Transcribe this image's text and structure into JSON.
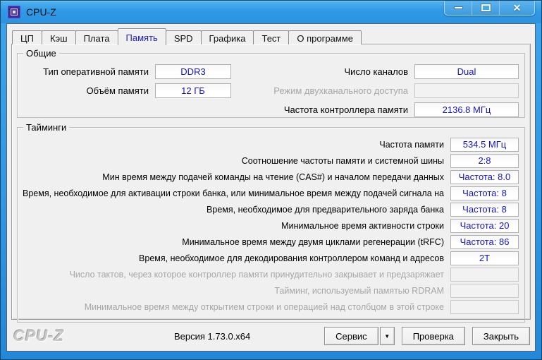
{
  "window": {
    "title": "CPU-Z",
    "controls": {
      "close_glyph": "✕"
    }
  },
  "tabs": [
    {
      "name": "tab-cpu",
      "label": "ЦП",
      "active": false
    },
    {
      "name": "tab-cache",
      "label": "Кэш",
      "active": false
    },
    {
      "name": "tab-mainboard",
      "label": "Плата",
      "active": false
    },
    {
      "name": "tab-memory",
      "label": "Память",
      "active": true
    },
    {
      "name": "tab-spd",
      "label": "SPD",
      "active": false
    },
    {
      "name": "tab-graphics",
      "label": "Графика",
      "active": false
    },
    {
      "name": "tab-bench",
      "label": "Тест",
      "active": false
    },
    {
      "name": "tab-about",
      "label": "О программе",
      "active": false
    }
  ],
  "general": {
    "group_title": "Общие",
    "left": [
      {
        "label": "Тип оперативной памяти",
        "value": "DDR3",
        "disabled": false
      },
      {
        "label": "Объём памяти",
        "value": "12 ГБ",
        "disabled": false
      }
    ],
    "right": [
      {
        "label": "Число каналов",
        "value": "Dual",
        "disabled": false
      },
      {
        "label": "Режим двухканального доступа",
        "value": "",
        "disabled": true
      },
      {
        "label": "Частота контроллера памяти",
        "value": "2136.8 МГц",
        "disabled": false
      }
    ]
  },
  "timings": {
    "group_title": "Тайминги",
    "rows": [
      {
        "label": "Частота памяти",
        "value": "534.5 МГц",
        "disabled": false
      },
      {
        "label": "Соотношение частоты памяти и системной шины",
        "value": "2:8",
        "disabled": false
      },
      {
        "label": "Мин время между подачей команды на чтение (CAS#) и началом передачи данных",
        "value": "Частота: 8.0",
        "disabled": false
      },
      {
        "label": "Время, необходимое для активации строки банка, или минимальное время между подачей сигнала на",
        "value": "Частота: 8",
        "disabled": false
      },
      {
        "label": "Время, необходимое для предварительного заряда банка",
        "value": "Частота: 8",
        "disabled": false
      },
      {
        "label": "Минимальное время активности строки",
        "value": "Частота: 20",
        "disabled": false
      },
      {
        "label": "Минимальное время между двумя циклами регенерации (tRFC)",
        "value": "Частота: 86",
        "disabled": false
      },
      {
        "label": "Время, необходимое для декодирования контроллером команд и адресов",
        "value": "2T",
        "disabled": false
      },
      {
        "label": "Число тактов, через которое контроллер памяти принудительно закрывает и предзаряжает",
        "value": "",
        "disabled": true
      },
      {
        "label": "Тайминг, используемый памятью RDRAM",
        "value": "",
        "disabled": true
      },
      {
        "label": "Минимальное время между открытием строки и операцией над столбцом в этой строке",
        "value": "",
        "disabled": true
      }
    ]
  },
  "footer": {
    "logo": "CPU-Z",
    "version": "Версия 1.73.0.x64",
    "buttons": {
      "tools": "Сервис",
      "tools_arrow": "▼",
      "validate": "Проверка",
      "close": "Закрыть"
    }
  },
  "colors": {
    "titlebar_blue": "#2f9ae7",
    "value_text_blue": "#1414c8",
    "active_tab_text": "#2121cc",
    "client_background": "#f0f0f0",
    "disabled_text": "#a6a6a6"
  }
}
